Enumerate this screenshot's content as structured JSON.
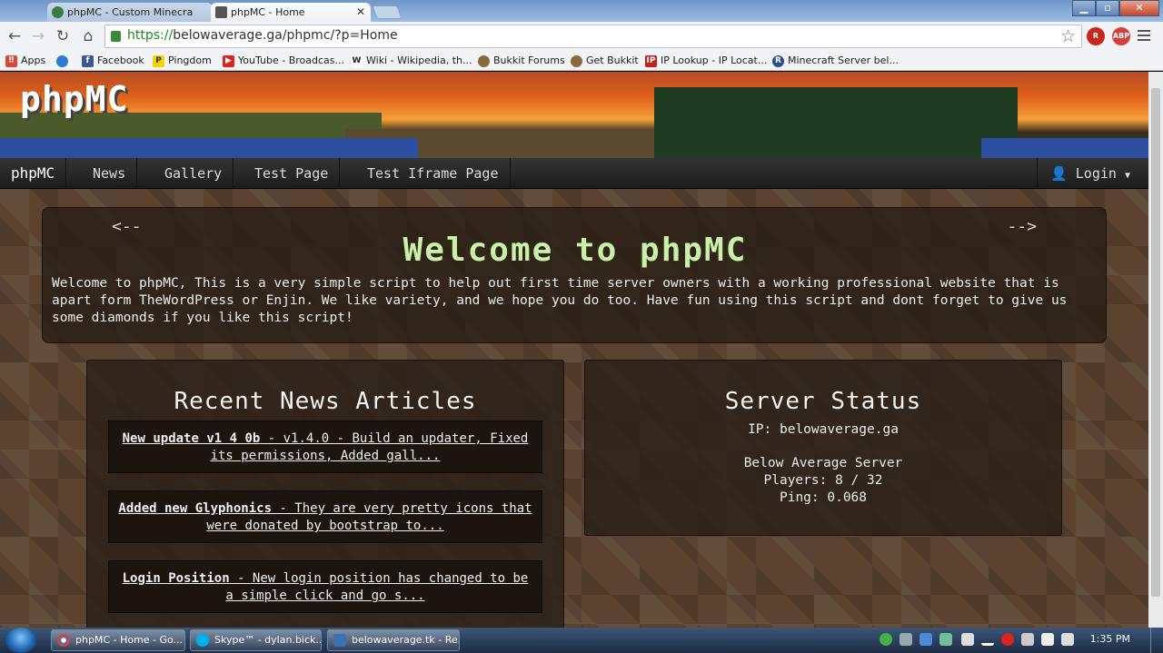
{
  "browser": {
    "tabs": [
      {
        "title": "phpMC - Custom Minecra",
        "active": false
      },
      {
        "title": "phpMC - Home",
        "active": true
      }
    ],
    "url_scheme": "https://",
    "url_rest": "belowaverage.ga/phpmc/?p=Home",
    "extensions": [
      "R",
      "ABP"
    ],
    "bookmarks": [
      {
        "label": "Apps",
        "icon": "apps-icon"
      },
      {
        "label": "",
        "icon": "globe-icon"
      },
      {
        "label": "Facebook",
        "icon": "facebook-icon"
      },
      {
        "label": "Pingdom",
        "icon": "pingdom-icon"
      },
      {
        "label": "YouTube - Broadcas...",
        "icon": "youtube-icon"
      },
      {
        "label": "Wiki - Wikipedia, th...",
        "icon": "wikipedia-icon"
      },
      {
        "label": "Bukkit Forums",
        "icon": "bukkit-icon"
      },
      {
        "label": "Get Bukkit",
        "icon": "bukkit-icon"
      },
      {
        "label": "IP Lookup - IP Locat...",
        "icon": "ip-icon"
      },
      {
        "label": "Minecraft Server bel...",
        "icon": "r-icon"
      }
    ]
  },
  "site": {
    "logo": "phpMC",
    "nav": {
      "brand": "phpMC",
      "items": [
        "News",
        "Gallery",
        "Test Page",
        "Test Iframe Page"
      ],
      "login": "Login"
    },
    "hero": {
      "prev": "<--",
      "next": "-->",
      "title": "Welcome to phpMC",
      "text": "Welcome to phpMC, This is a very simple script to help out first time server owners with a working professional website that is apart form TheWordPress or Enjin. We like variety, and we hope you do too. Have fun using this script and dont forget to give us some diamonds if you like this script!"
    },
    "news": {
      "title": "Recent News Articles",
      "articles": [
        {
          "headline": "New update v1 4 0b",
          "summary": " - v1.4.0 - Build an updater, Fixed its permissions, Added gall..."
        },
        {
          "headline": "Added new Glyphonics",
          "summary": " - They are very pretty icons that were donated by bootstrap to..."
        },
        {
          "headline": "Login Position",
          "summary": " - New login position has changed to be a simple click and go s..."
        }
      ]
    },
    "status": {
      "title": "Server Status",
      "ip": "IP: belowaverage.ga",
      "name": "Below Average Server",
      "players": "Players: 8 / 32",
      "ping": "Ping: 0.068"
    }
  },
  "taskbar": {
    "tasks": [
      {
        "label": "phpMC - Home - Go..."
      },
      {
        "label": "Skype™ - dylan.bick..."
      },
      {
        "label": "belowaverage.tk - Re..."
      }
    ],
    "clock": "1:35 PM"
  },
  "colors": {
    "hero_title": "#c8f0a8",
    "page_bg": "#5b4330",
    "nav_bg": "#262626"
  }
}
